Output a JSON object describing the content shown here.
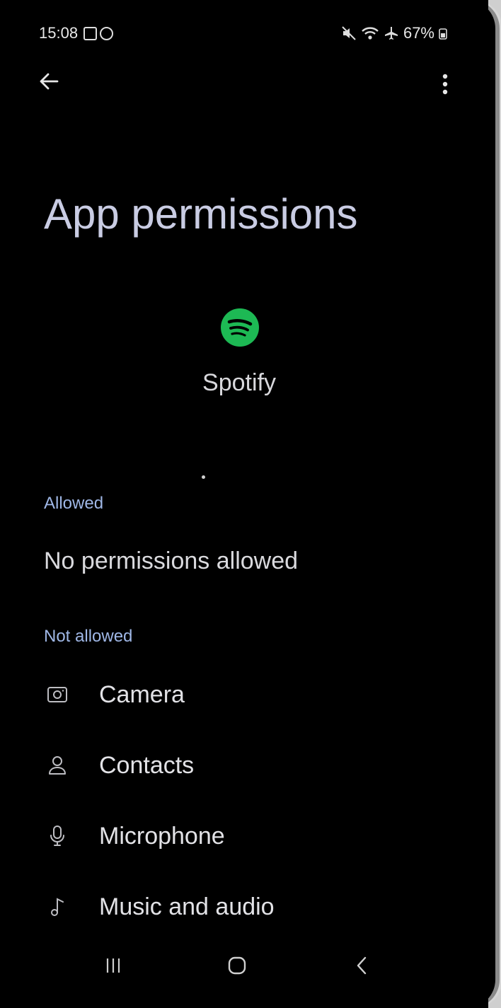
{
  "status_bar": {
    "time": "15:08",
    "battery": "67%"
  },
  "header": {
    "title": "App permissions"
  },
  "app": {
    "name": "Spotify",
    "icon_color": "#1DB954"
  },
  "sections": {
    "allowed": {
      "label": "Allowed",
      "empty_text": "No permissions allowed"
    },
    "not_allowed": {
      "label": "Not allowed",
      "items": [
        {
          "label": "Camera",
          "icon": "camera-icon"
        },
        {
          "label": "Contacts",
          "icon": "person-icon"
        },
        {
          "label": "Microphone",
          "icon": "microphone-icon"
        },
        {
          "label": "Music and audio",
          "icon": "music-note-icon"
        }
      ]
    }
  },
  "colors": {
    "background": "#000000",
    "section_label": "#9fb7e6",
    "title": "#c9cce3"
  }
}
